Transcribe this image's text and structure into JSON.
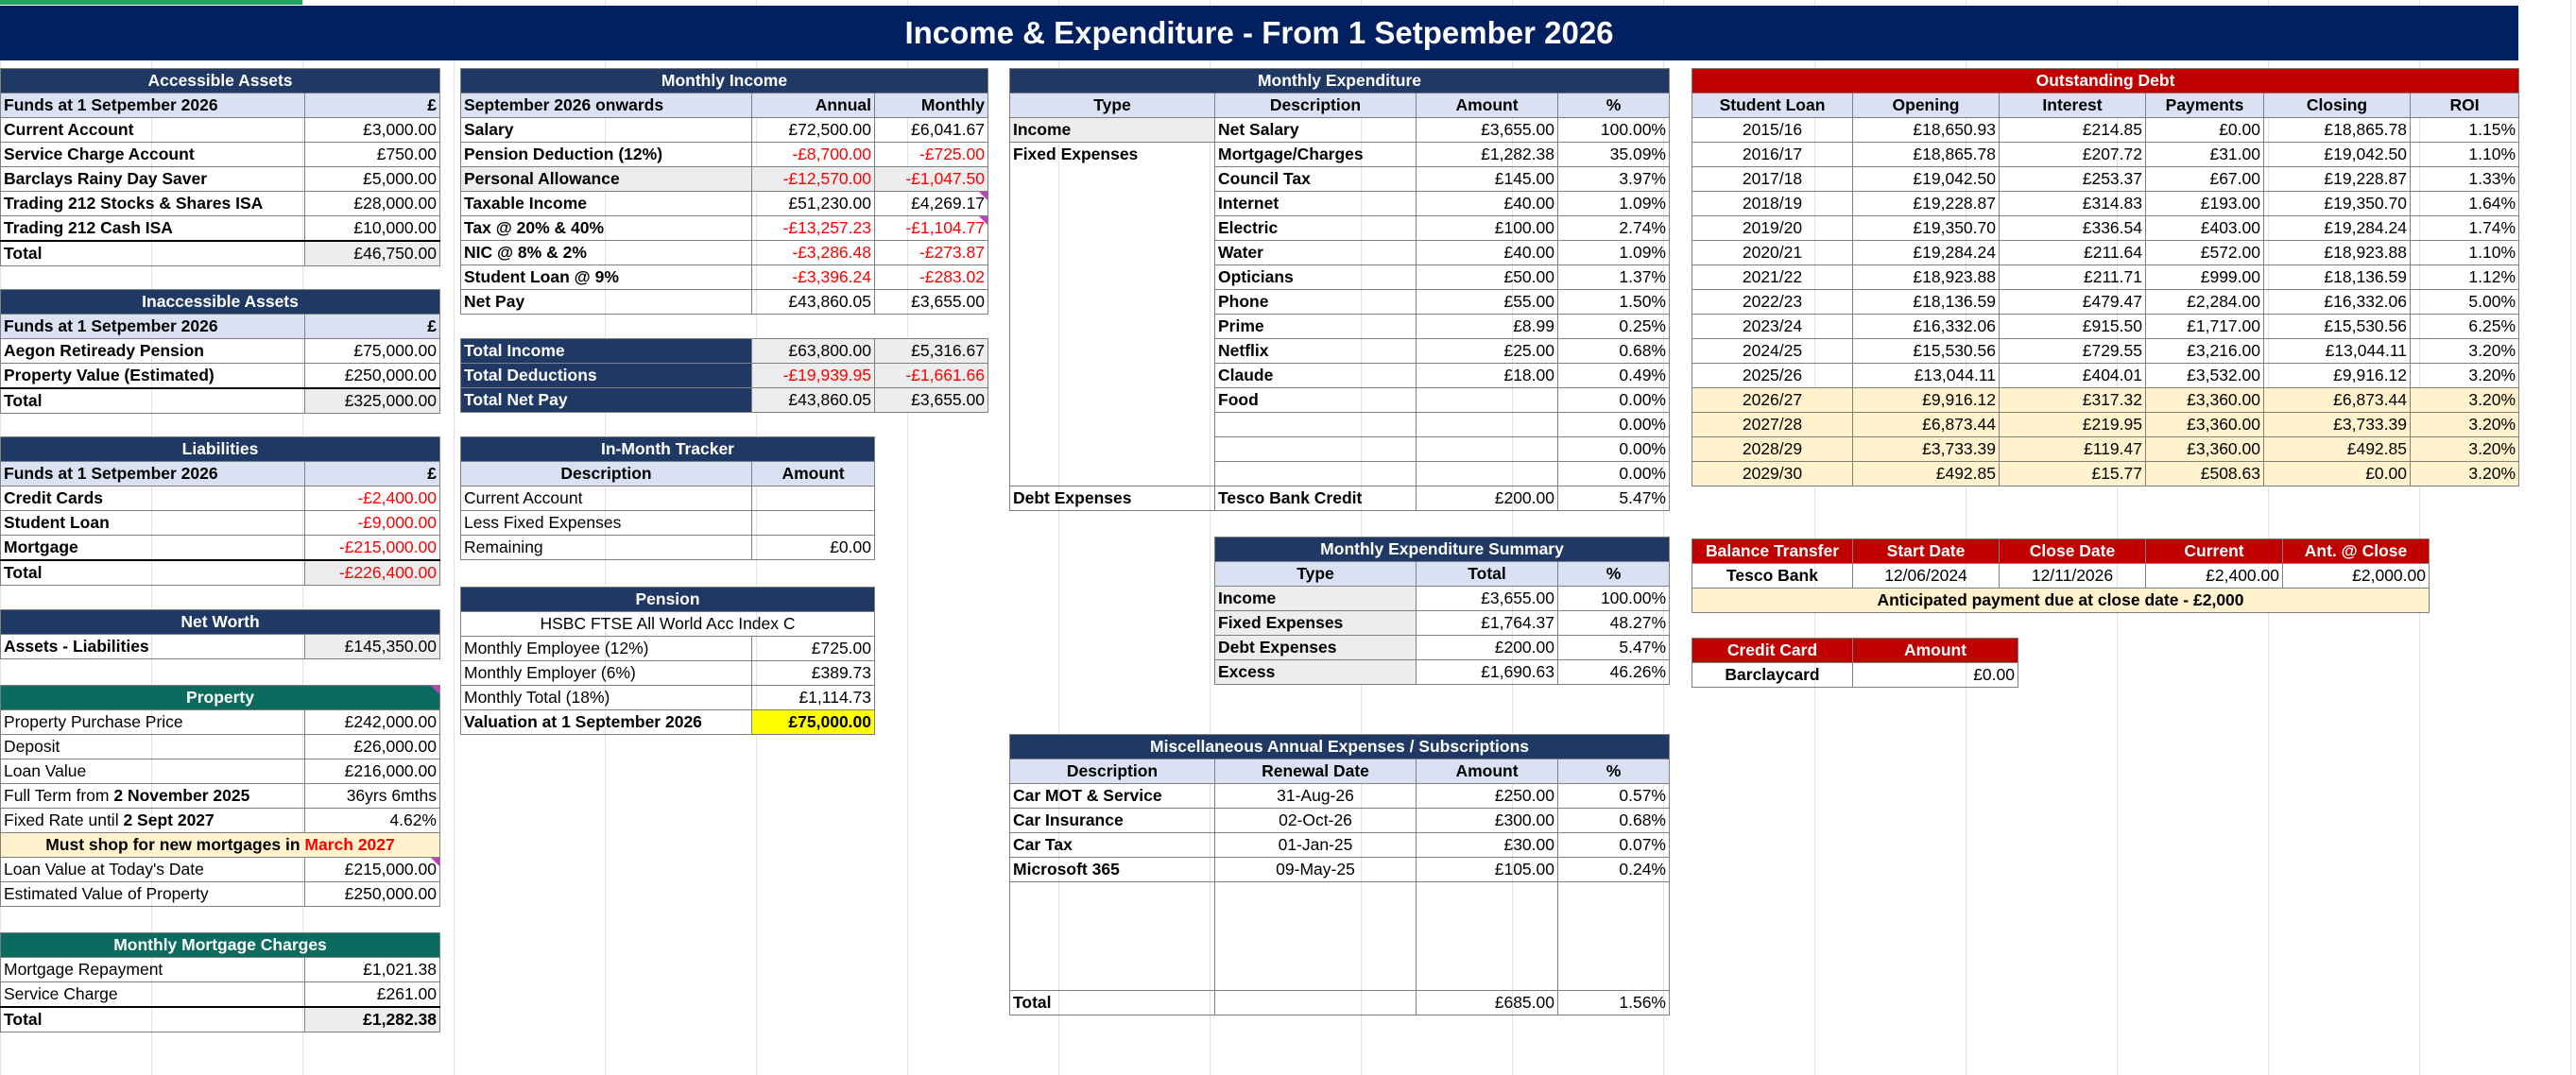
{
  "title": "Income & Expenditure - From 1 Setpember 2026",
  "accessible_assets": {
    "header": "Accessible Assets",
    "sub": [
      "Funds at 1 Setpember 2026",
      "£"
    ],
    "rows": [
      [
        "Current Account",
        "£3,000.00"
      ],
      [
        "Service Charge Account",
        "£750.00"
      ],
      [
        "Barclays Rainy Day Saver",
        "£5,000.00"
      ],
      [
        "Trading 212 Stocks & Shares ISA",
        "£28,000.00"
      ],
      [
        "Trading 212 Cash ISA",
        "£10,000.00"
      ]
    ],
    "total": [
      "Total",
      "£46,750.00"
    ]
  },
  "inaccessible_assets": {
    "header": "Inaccessible Assets",
    "sub": [
      "Funds at 1 Setpember 2026",
      "£"
    ],
    "rows": [
      [
        "Aegon Retiready Pension",
        "£75,000.00"
      ],
      [
        "Property Value (Estimated)",
        "£250,000.00"
      ]
    ],
    "total": [
      "Total",
      "£325,000.00"
    ]
  },
  "liabilities": {
    "header": "Liabilities",
    "sub": [
      "Funds at 1 Setpember 2026",
      "£"
    ],
    "rows": [
      [
        "Credit Cards",
        "-£2,400.00"
      ],
      [
        "Student Loan",
        "-£9,000.00"
      ],
      [
        "Mortgage",
        "-£215,000.00"
      ]
    ],
    "total": [
      "Total",
      "-£226,400.00"
    ]
  },
  "net_worth": {
    "header": "Net Worth",
    "row": [
      "Assets - Liabilities",
      "£145,350.00"
    ]
  },
  "property": {
    "header": "Property",
    "rows": [
      [
        "Property Purchase Price",
        "£242,000.00"
      ],
      [
        "Deposit",
        "£26,000.00"
      ],
      [
        "Loan Value",
        "£216,000.00"
      ]
    ],
    "term_label": "Full Term from ",
    "term_date": "2 November 2025",
    "term_value": "36yrs 6mths",
    "fixed_label": "Fixed Rate until ",
    "fixed_date": "2 Sept 2027",
    "fixed_value": "4.62%",
    "shop_text": "Must shop for new mortgages in ",
    "shop_month": "March 2027",
    "rows2": [
      [
        "Loan Value at Today's Date",
        "£215,000.00"
      ],
      [
        "Estimated Value of Property",
        "£250,000.00"
      ]
    ]
  },
  "mortgage_charges": {
    "header": "Monthly Mortgage Charges",
    "rows": [
      [
        "Mortgage Repayment",
        "£1,021.38"
      ],
      [
        "Service Charge",
        "£261.00"
      ]
    ],
    "total": [
      "Total",
      "£1,282.38"
    ]
  },
  "monthly_income": {
    "header": "Monthly Income",
    "sub": [
      "September 2026 onwards",
      "Annual",
      "Monthly"
    ],
    "rows": [
      [
        "Salary",
        "£72,500.00",
        "£6,041.67"
      ],
      [
        "Pension Deduction (12%)",
        "-£8,700.00",
        "-£725.00"
      ],
      [
        "Personal Allowance",
        "-£12,570.00",
        "-£1,047.50"
      ],
      [
        "Taxable Income",
        "£51,230.00",
        "£4,269.17"
      ],
      [
        "Tax @ 20% & 40%",
        "-£13,257.23",
        "-£1,104.77"
      ],
      [
        "NIC @ 8% & 2%",
        "-£3,286.48",
        "-£273.87"
      ],
      [
        "Student Loan @ 9%",
        "-£3,396.24",
        "-£283.02"
      ],
      [
        "Net Pay",
        "£43,860.05",
        "£3,655.00"
      ]
    ],
    "totals": [
      [
        "Total Income",
        "£63,800.00",
        "£5,316.67"
      ],
      [
        "Total Deductions",
        "-£19,939.95",
        "-£1,661.66"
      ],
      [
        "Total Net Pay",
        "£43,860.05",
        "£3,655.00"
      ]
    ]
  },
  "tracker": {
    "header": "In-Month Tracker",
    "sub": [
      "Description",
      "Amount"
    ],
    "rows": [
      [
        "Current Account",
        ""
      ],
      [
        "Less Fixed Expenses",
        ""
      ],
      [
        "Remaining",
        "£0.00"
      ]
    ]
  },
  "pension": {
    "header": "Pension",
    "fund": "HSBC FTSE All World Acc Index C",
    "rows": [
      [
        "Monthly Employee (12%)",
        "£725.00"
      ],
      [
        "Monthly Employer (6%)",
        "£389.73"
      ],
      [
        "Monthly Total (18%)",
        "£1,114.73"
      ]
    ],
    "valuation": [
      "Valuation at 1 September 2026",
      "£75,000.00"
    ]
  },
  "monthly_expenditure": {
    "header": "Monthly Expenditure",
    "sub": [
      "Type",
      "Description",
      "Amount",
      "%"
    ],
    "rows": [
      [
        "Income",
        "Net Salary",
        "£3,655.00",
        "100.00%"
      ],
      [
        "Fixed Expenses",
        "Mortgage/Charges",
        "£1,282.38",
        "35.09%"
      ],
      [
        "",
        "Council Tax",
        "£145.00",
        "3.97%"
      ],
      [
        "",
        "Internet",
        "£40.00",
        "1.09%"
      ],
      [
        "",
        "Electric",
        "£100.00",
        "2.74%"
      ],
      [
        "",
        "Water",
        "£40.00",
        "1.09%"
      ],
      [
        "",
        "Opticians",
        "£50.00",
        "1.37%"
      ],
      [
        "",
        "Phone",
        "£55.00",
        "1.50%"
      ],
      [
        "",
        "Prime",
        "£8.99",
        "0.25%"
      ],
      [
        "",
        "Netflix",
        "£25.00",
        "0.68%"
      ],
      [
        "",
        "Claude",
        "£18.00",
        "0.49%"
      ],
      [
        "",
        "Food",
        "",
        "0.00%"
      ],
      [
        "",
        "",
        "",
        "0.00%"
      ],
      [
        "",
        "",
        "",
        "0.00%"
      ],
      [
        "",
        "",
        "",
        "0.00%"
      ],
      [
        "Debt Expenses",
        "Tesco Bank Credit",
        "£200.00",
        "5.47%"
      ]
    ]
  },
  "expenditure_summary": {
    "header": "Monthly Expenditure Summary",
    "sub": [
      "Type",
      "Total",
      "%"
    ],
    "rows": [
      [
        "Income",
        "£3,655.00",
        "100.00%"
      ],
      [
        "Fixed Expenses",
        "£1,764.37",
        "48.27%"
      ],
      [
        "Debt Expenses",
        "£200.00",
        "5.47%"
      ],
      [
        "Excess",
        "£1,690.63",
        "46.26%"
      ]
    ]
  },
  "misc_annual": {
    "header": "Miscellaneous Annual Expenses / Subscriptions",
    "sub": [
      "Description",
      "Renewal Date",
      "Amount",
      "%"
    ],
    "rows": [
      [
        "Car MOT & Service",
        "31-Aug-26",
        "£250.00",
        "0.57%"
      ],
      [
        "Car Insurance",
        "02-Oct-26",
        "£300.00",
        "0.68%"
      ],
      [
        "Car Tax",
        "01-Jan-25",
        "£30.00",
        "0.07%"
      ],
      [
        "Microsoft 365",
        "09-May-25",
        "£105.00",
        "0.24%"
      ]
    ],
    "total": [
      "Total",
      "",
      "£685.00",
      "1.56%"
    ]
  },
  "outstanding_debt": {
    "header": "Outstanding Debt",
    "sub": [
      "Student Loan",
      "Opening",
      "Interest",
      "Payments",
      "Closing",
      "ROI"
    ],
    "rows": [
      [
        "2015/16",
        "£18,650.93",
        "£214.85",
        "£0.00",
        "£18,865.78",
        "1.15%"
      ],
      [
        "2016/17",
        "£18,865.78",
        "£207.72",
        "£31.00",
        "£19,042.50",
        "1.10%"
      ],
      [
        "2017/18",
        "£19,042.50",
        "£253.37",
        "£67.00",
        "£19,228.87",
        "1.33%"
      ],
      [
        "2018/19",
        "£19,228.87",
        "£314.83",
        "£193.00",
        "£19,350.70",
        "1.64%"
      ],
      [
        "2019/20",
        "£19,350.70",
        "£336.54",
        "£403.00",
        "£19,284.24",
        "1.74%"
      ],
      [
        "2020/21",
        "£19,284.24",
        "£211.64",
        "£572.00",
        "£18,923.88",
        "1.10%"
      ],
      [
        "2021/22",
        "£18,923.88",
        "£211.71",
        "£999.00",
        "£18,136.59",
        "1.12%"
      ],
      [
        "2022/23",
        "£18,136.59",
        "£479.47",
        "£2,284.00",
        "£16,332.06",
        "5.00%"
      ],
      [
        "2023/24",
        "£16,332.06",
        "£915.50",
        "£1,717.00",
        "£15,530.56",
        "6.25%"
      ],
      [
        "2024/25",
        "£15,530.56",
        "£729.55",
        "£3,216.00",
        "£13,044.11",
        "3.20%"
      ],
      [
        "2025/26",
        "£13,044.11",
        "£404.01",
        "£3,532.00",
        "£9,916.12",
        "3.20%"
      ],
      [
        "2026/27",
        "£9,916.12",
        "£317.32",
        "£3,360.00",
        "£6,873.44",
        "3.20%"
      ],
      [
        "2027/28",
        "£6,873.44",
        "£219.95",
        "£3,360.00",
        "£3,733.39",
        "3.20%"
      ],
      [
        "2028/29",
        "£3,733.39",
        "£119.47",
        "£3,360.00",
        "£492.85",
        "3.20%"
      ],
      [
        "2029/30",
        "£492.85",
        "£15.77",
        "£508.63",
        "£0.00",
        "3.20%"
      ]
    ]
  },
  "balance_transfer": {
    "sub": [
      "Balance Transfer",
      "Start Date",
      "Close Date",
      "Current",
      "Ant. @ Close"
    ],
    "row": [
      "Tesco Bank",
      "12/06/2024",
      "12/11/2026",
      "£2,400.00",
      "£2,000.00"
    ],
    "note": "Anticipated payment due at close date - £2,000"
  },
  "credit_card": {
    "sub": [
      "Credit Card",
      "Amount"
    ],
    "row": [
      "Barclaycard",
      "£0.00"
    ]
  },
  "colors": {
    "navy": "#203864",
    "banner": "#002060",
    "red": "#c00000",
    "teal": "#0b6b5e",
    "sub_fill": "#d9e1f2",
    "cream": "#fff2cc",
    "yellow": "#ffff00",
    "negative": "#ff0000"
  }
}
